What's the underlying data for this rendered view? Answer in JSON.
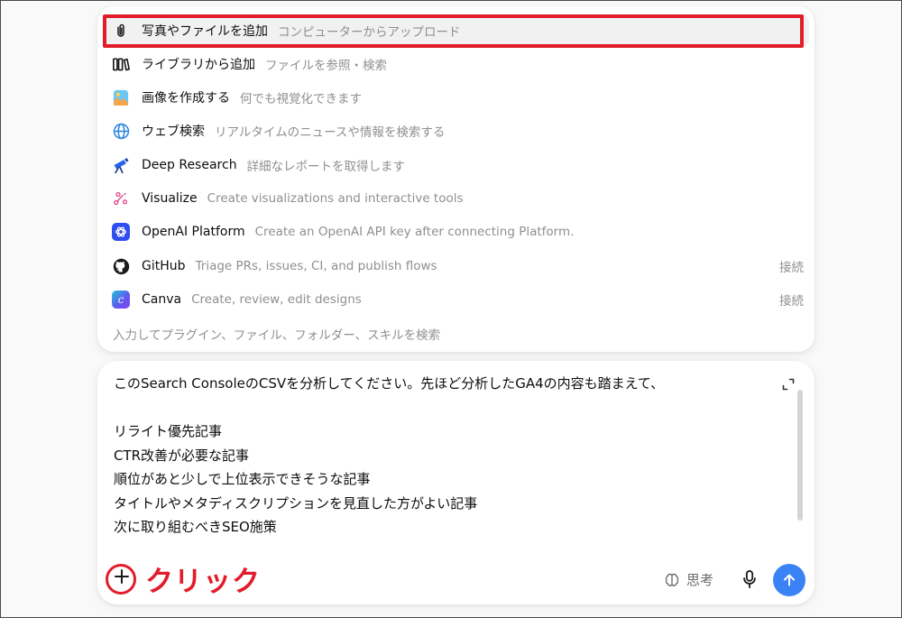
{
  "menu": {
    "items": [
      {
        "label": "写真やファイルを追加",
        "desc": "コンピューターからアップロード",
        "icon": "paperclip-icon",
        "right": ""
      },
      {
        "label": "ライブラリから追加",
        "desc": "ファイルを参照・検索",
        "icon": "library-icon",
        "right": ""
      },
      {
        "label": "画像を作成する",
        "desc": "何でも視覚化できます",
        "icon": "image-icon",
        "right": ""
      },
      {
        "label": "ウェブ検索",
        "desc": "リアルタイムのニュースや情報を検索する",
        "icon": "globe-icon",
        "right": ""
      },
      {
        "label": "Deep Research",
        "desc": "詳細なレポートを取得します",
        "icon": "telescope-icon",
        "right": ""
      },
      {
        "label": "Visualize",
        "desc": "Create visualizations and interactive tools",
        "icon": "visualize-icon",
        "right": ""
      },
      {
        "label": "OpenAI Platform",
        "desc": "Create an OpenAI API key after connecting Platform.",
        "icon": "openai-icon",
        "right": ""
      },
      {
        "label": "GitHub",
        "desc": "Triage PRs, issues, CI, and publish flows",
        "icon": "github-icon",
        "right": "接続"
      },
      {
        "label": "Canva",
        "desc": "Create, review, edit designs",
        "icon": "canva-icon",
        "right": "接続"
      }
    ],
    "search_placeholder": "入力してプラグイン、ファイル、フォルダー、スキルを検索"
  },
  "composer": {
    "lines": [
      "このSearch ConsoleのCSVを分析してください。先ほど分析したGA4の内容も踏まえて、",
      "",
      "リライト優先記事",
      "CTR改善が必要な記事",
      "順位があと少しで上位表示できそうな記事",
      "タイトルやメタディスクリプションを見直した方がよい記事",
      "次に取り組むべきSEO施策"
    ],
    "think_label": "思考"
  },
  "annotation": {
    "text": "クリック",
    "color": "#e11d2a"
  },
  "colors": {
    "accent": "#3b82f6",
    "annotation_red": "#e11d2a"
  }
}
